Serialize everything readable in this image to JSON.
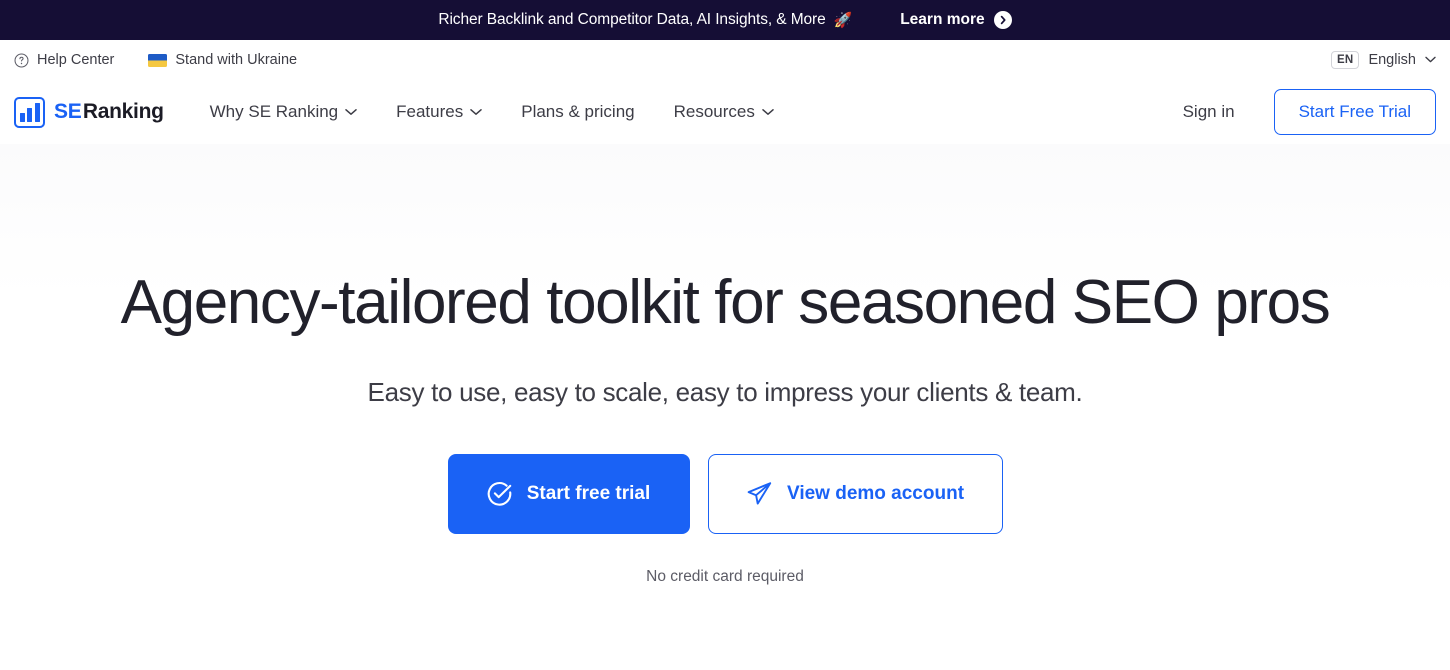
{
  "promo_banner": {
    "text": "Richer Backlink and Competitor Data, AI Insights, & More",
    "emoji": "🚀",
    "link_label": "Learn more",
    "link_icon": "chevron-right-circle-icon",
    "background_color": "#150E35",
    "text_color": "#FFFFFF"
  },
  "utility_bar": {
    "help_center": {
      "label": "Help Center",
      "icon": "question-circle-icon"
    },
    "ukraine": {
      "label": "Stand with Ukraine",
      "icon": "ukraine-flag-icon"
    },
    "language": {
      "code": "EN",
      "label": "English",
      "icon": "chevron-down-icon"
    }
  },
  "main_nav": {
    "brand": {
      "name_prefix": "SE",
      "name_suffix": "Ranking",
      "icon": "bar-chart-logo-icon"
    },
    "links": [
      {
        "label": "Why SE Ranking",
        "has_dropdown": true
      },
      {
        "label": "Features",
        "has_dropdown": true
      },
      {
        "label": "Plans & pricing",
        "has_dropdown": false
      },
      {
        "label": "Resources",
        "has_dropdown": true
      }
    ],
    "sign_in_label": "Sign in",
    "trial_button_label": "Start Free Trial"
  },
  "hero": {
    "title": "Agency-tailored toolkit for seasoned SEO pros",
    "subtitle": "Easy to use, easy to scale, easy to impress your clients & team.",
    "primary_cta": {
      "label": "Start free trial",
      "icon": "check-circle-icon"
    },
    "secondary_cta": {
      "label": "View demo account",
      "icon": "paper-plane-icon"
    },
    "note": "No credit card required"
  },
  "colors": {
    "brand_blue": "#1A62F5",
    "banner_navy": "#150E35",
    "text_dark": "#21212B",
    "text_muted": "#3D3D46"
  }
}
